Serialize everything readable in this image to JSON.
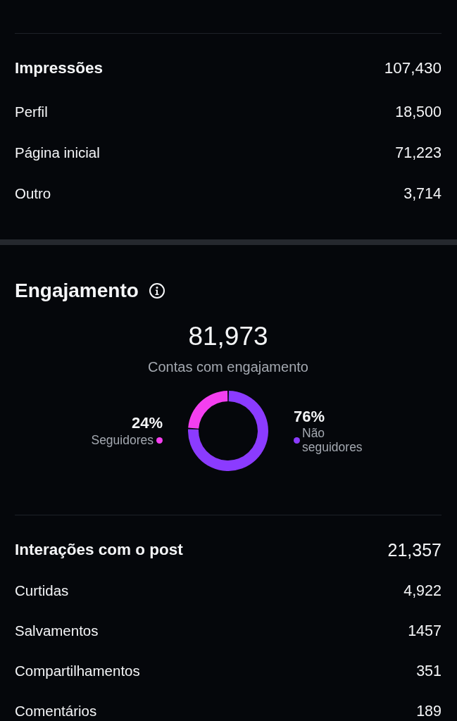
{
  "impressions": {
    "title": "Impressões",
    "total": "107,430",
    "rows": [
      {
        "label": "Perfil",
        "value": "18,500"
      },
      {
        "label": "Página inicial",
        "value": "71,223"
      },
      {
        "label": "Outro",
        "value": "3,714"
      }
    ]
  },
  "engagement": {
    "title": "Engajamento",
    "total": "81,973",
    "caption": "Contas com engajamento",
    "chart_data": {
      "type": "donut",
      "categories": [
        "Seguidores",
        "Não seguidores"
      ],
      "values": [
        24,
        76
      ]
    },
    "legend": [
      {
        "percent": "24%",
        "color": "#f43ff0"
      },
      {
        "percent": "76%",
        "color": "#8b3bff"
      }
    ]
  },
  "interactions": {
    "title": "Interações com o post",
    "total": "21,357",
    "rows": [
      {
        "label": "Curtidas",
        "value": "4,922"
      },
      {
        "label": "Salvamentos",
        "value": "1457"
      },
      {
        "label": "Compartilhamentos",
        "value": "351"
      },
      {
        "label": "Comentários",
        "value": "189"
      }
    ]
  }
}
